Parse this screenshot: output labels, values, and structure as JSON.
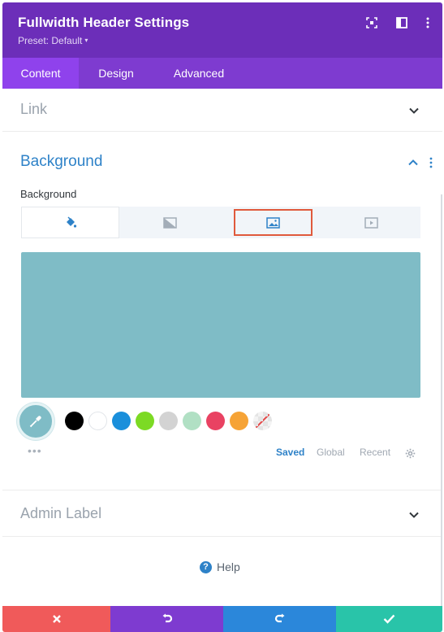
{
  "header": {
    "title": "Fullwidth Header Settings",
    "preset_label": "Preset: Default",
    "preset_caret": "▾",
    "icons": [
      "screenshot-icon",
      "sidebar-layout-icon",
      "more-options-icon"
    ]
  },
  "tabs": [
    {
      "label": "Content",
      "active": true
    },
    {
      "label": "Design",
      "active": false
    },
    {
      "label": "Advanced",
      "active": false
    }
  ],
  "sections": {
    "link": {
      "title": "Link",
      "expanded": false
    },
    "background": {
      "title": "Background",
      "expanded": true,
      "field_label": "Background",
      "type_tabs": [
        {
          "icon": "paint-bucket-icon",
          "active": true
        },
        {
          "icon": "gradient-icon",
          "active": false
        },
        {
          "icon": "image-icon",
          "active": false,
          "highlighted": true
        },
        {
          "icon": "video-icon",
          "active": false
        }
      ],
      "selected_color": "#7fbcc6",
      "swatches": [
        "#000000",
        "#ffffff",
        "#1a8fdb",
        "#7cda24",
        "#d3d3d3",
        "#b1e0c4",
        "#e94262",
        "#f6a336",
        "transparent"
      ],
      "more_label": "•••",
      "palette_tabs": [
        {
          "label": "Saved",
          "active": true
        },
        {
          "label": "Global",
          "active": false
        },
        {
          "label": "Recent",
          "active": false
        }
      ]
    },
    "admin_label": {
      "title": "Admin Label",
      "expanded": false
    }
  },
  "help": {
    "label": "Help",
    "icon_glyph": "?"
  },
  "footer": {
    "buttons": [
      {
        "name": "cancel",
        "color": "#f05a5a"
      },
      {
        "name": "undo",
        "color": "#7e3bd0"
      },
      {
        "name": "redo",
        "color": "#2b87da"
      },
      {
        "name": "save",
        "color": "#29c4a9"
      }
    ]
  },
  "colors": {
    "header_bg": "#6c2eb9",
    "tabs_bg": "#7e3bd0",
    "active_tab_bg": "#8f42ec",
    "accent_blue": "#2e82c8"
  }
}
